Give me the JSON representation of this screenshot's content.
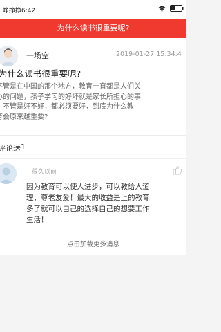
{
  "status_bar": {
    "time": "睁挣挣6:42",
    "battery": "31"
  },
  "header": {
    "title": "为什么读书很重要呢?"
  },
  "post": {
    "author": "一场空",
    "date": "2019-01-27 15:34:4",
    "title": "为什么读书很重要呢?",
    "body_lines": [
      "不管是在中国的那个地方，教育一直都是人们关",
      "心的问题，孩子学习的好坏就是家长所担心的事",
      "，不管是好不好，都必须要好，到底为什么教",
      "育会原来越重要?"
    ]
  },
  "comments_section": {
    "label": "评论送",
    "count": "1"
  },
  "comment": {
    "time": "很久以前",
    "text_lines": [
      "因为教育可以使人进步，可以教给人道",
      "理，尊老友爱！最大的收益是上的教育",
      "多了就可以自己的选择自己的想要工作",
      "生活！"
    ]
  },
  "load_more": {
    "label": "点击加载更多消息"
  },
  "colors": {
    "accent": "#f13a2f"
  }
}
